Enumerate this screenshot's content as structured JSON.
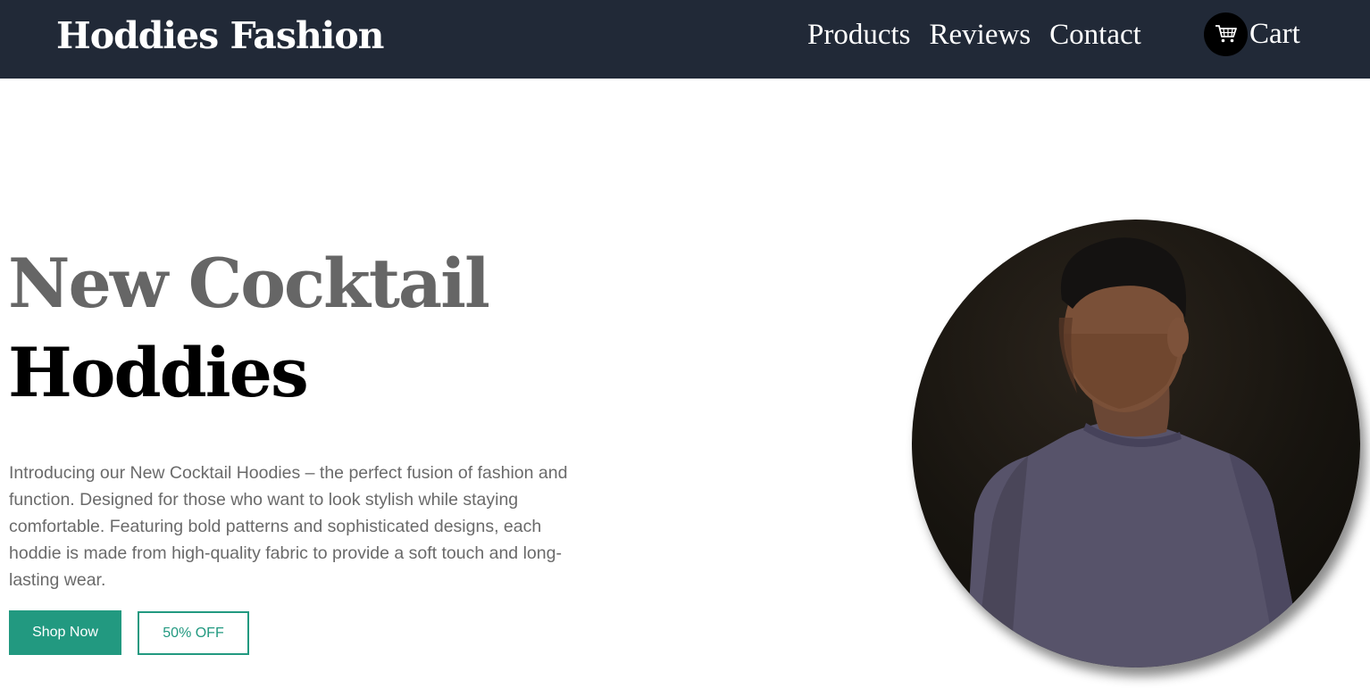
{
  "header": {
    "brand": "Hoddies Fashion",
    "nav": [
      {
        "label": "Products"
      },
      {
        "label": "Reviews"
      },
      {
        "label": "Contact"
      }
    ],
    "cart": {
      "label": "Cart",
      "icon": "cart-icon"
    }
  },
  "hero": {
    "title_line1": "New Cocktail",
    "title_line2": "Hoddies",
    "description": "Introducing our New Cocktail Hoodies – the perfect fusion of fashion and function. Designed for those who want to look stylish while staying comfortable. Featuring bold patterns and sophisticated designs, each hoddie is made from high-quality fabric to provide a soft touch and long-lasting wear.",
    "primary_button": "Shop Now",
    "secondary_button": "50% OFF",
    "image": "model-photo"
  },
  "colors": {
    "navbar_bg": "#212937",
    "accent": "#229980",
    "title_gray": "#666666",
    "body_text": "#6a6a6a"
  }
}
